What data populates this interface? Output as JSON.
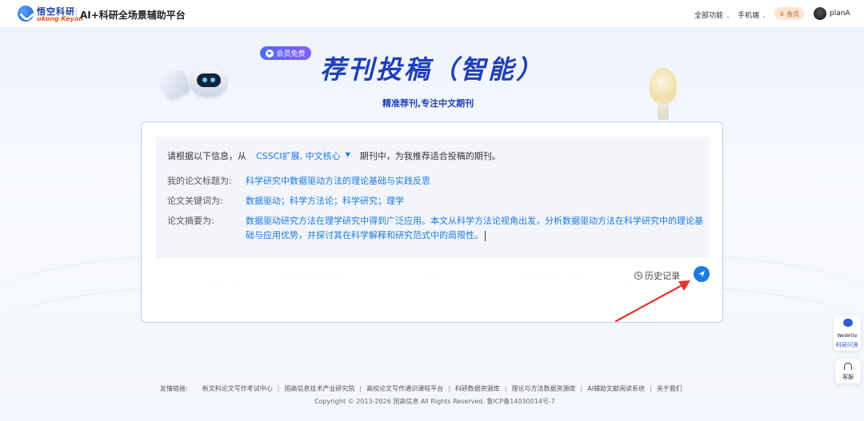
{
  "topbar": {
    "logo_cn": "悟空科研",
    "logo_en": "ukong Keyan",
    "app_title": "AI+科研全场景辅助平台",
    "nav": [
      "全部功能",
      "手机端"
    ],
    "vip_label": "会员",
    "username": "planA"
  },
  "hero": {
    "member_tag": "会员免费",
    "title": "荐刊投稿（智能）",
    "subtitle": "精准荐刊,专注中文期刊"
  },
  "form": {
    "intro_prefix": "请根据以下信息，从",
    "selected_journals": "CSSCI扩展, 中文核心",
    "intro_suffix": "期刊中，为我推荐适合投稿的期刊。",
    "title_label": "我的论文标题为:",
    "title_value": "科学研究中数据驱动方法的理论基础与实践反思",
    "keywords_label": "论文关键词为:",
    "keywords_value": "数据驱动；科学方法论；科学研究；理学",
    "abstract_label": "论文摘要为:",
    "abstract_value": "数据驱动研究方法在理学研究中得到广泛应用。本文从科学方法论视角出发，分析数据驱动方法在科学研究中的理论基础与应用优势，并探讨其在科学解释和研究范式中的局限性。",
    "history_label": "历史记录"
  },
  "side": {
    "wewrite_label": "WeWrite",
    "wewrite_sub": "科研问答",
    "cs_label": "客服"
  },
  "footer": {
    "links_label": "友情链接:",
    "links": [
      "新文科论文写作考试中心",
      "国高信息技术产业研究院",
      "高校论文写作通识课程平台",
      "科研数据资源库",
      "理论与方法数据资源库",
      "AI辅助文献阅读系统",
      "关于我们"
    ],
    "copyright": "Copyright © 2013-2026 国高信息 All Rights Reserved.   鲁ICP备14030014号-7"
  },
  "colors": {
    "accent": "#1a7be0",
    "title_blue": "#1e3fb8",
    "arrow_red": "#e8332a"
  }
}
